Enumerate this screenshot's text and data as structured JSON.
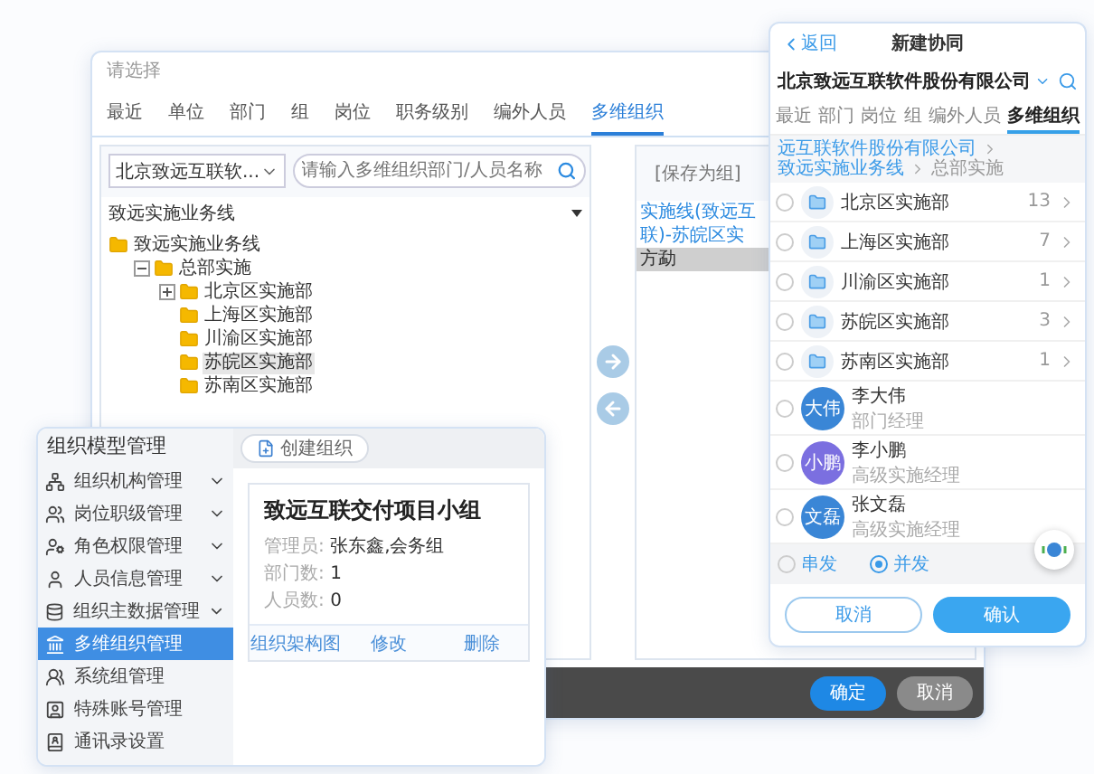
{
  "selector_dialog": {
    "title": "请选择",
    "tabs": [
      {
        "label": "最近",
        "selected": false
      },
      {
        "label": "单位",
        "selected": false
      },
      {
        "label": "部门",
        "selected": false
      },
      {
        "label": "组",
        "selected": false
      },
      {
        "label": "岗位",
        "selected": false
      },
      {
        "label": "职务级别",
        "selected": false
      },
      {
        "label": "编外人员",
        "selected": false
      },
      {
        "label": "多维组织",
        "selected": true
      }
    ],
    "unit_select": {
      "value": "北京致远互联软..."
    },
    "search": {
      "placeholder": "请输入多维组织部门/人员名称"
    },
    "tree_header": "致远实施业务线",
    "tree": [
      {
        "label": "致远实施业务线",
        "selected": false,
        "children": [
          {
            "label": "总部实施",
            "selected": false,
            "expanded": true,
            "children": [
              {
                "label": "北京区实施部",
                "selected": false,
                "expanded": false
              },
              {
                "label": "上海区实施部",
                "selected": false
              },
              {
                "label": "川渝区实施部",
                "selected": false
              },
              {
                "label": "苏皖区实施部",
                "selected": true
              },
              {
                "label": "苏南区实施部",
                "selected": false
              }
            ]
          }
        ]
      }
    ],
    "selected_panel": {
      "save_link": "[保存为组]",
      "items": [
        {
          "label": "实施线(致远互联)-苏皖区实",
          "kind": "path",
          "selected": false
        },
        {
          "label": "方勐",
          "kind": "person",
          "selected": true
        }
      ]
    },
    "buttons": [
      {
        "label": "确定",
        "kind": "primary"
      },
      {
        "label": "取消",
        "kind": "secondary"
      }
    ]
  },
  "org_admin": {
    "title": "组织模型管理",
    "menu": [
      {
        "label": "组织机构管理",
        "expandable": true,
        "selected": false
      },
      {
        "label": "岗位职级管理",
        "expandable": true,
        "selected": false
      },
      {
        "label": "角色权限管理",
        "expandable": true,
        "selected": false
      },
      {
        "label": "人员信息管理",
        "expandable": true,
        "selected": false
      },
      {
        "label": "组织主数据管理",
        "expandable": true,
        "selected": false
      },
      {
        "label": "多维组织管理",
        "expandable": false,
        "selected": true
      },
      {
        "label": "系统组管理",
        "expandable": false,
        "selected": false
      },
      {
        "label": "特殊账号管理",
        "expandable": false,
        "selected": false
      },
      {
        "label": "通讯录设置",
        "expandable": false,
        "selected": false
      }
    ],
    "create_button": "创建组织",
    "card": {
      "title": "致远互联交付项目小组",
      "fields": [
        {
          "label": "管理员:",
          "value": "张东鑫,会务组"
        },
        {
          "label": "部门数:",
          "value": "1"
        },
        {
          "label": "人员数:",
          "value": "0"
        }
      ],
      "actions": [
        "组织架构图",
        "修改",
        "删除"
      ]
    }
  },
  "mobile": {
    "back": "返回",
    "title": "新建协同",
    "company": "北京致远互联软件股份有限公司",
    "tabs": [
      {
        "label": "最近",
        "selected": false
      },
      {
        "label": "部门",
        "selected": false
      },
      {
        "label": "岗位",
        "selected": false
      },
      {
        "label": "组",
        "selected": false
      },
      {
        "label": "编外人员",
        "selected": false
      },
      {
        "label": "多维组织",
        "selected": true
      }
    ],
    "breadcrumb": [
      {
        "label": "远互联软件股份有限公司",
        "current": false
      },
      {
        "label": "致远实施业务线",
        "current": false
      },
      {
        "label": "总部实施",
        "current": true
      }
    ],
    "rows": [
      {
        "kind": "dept",
        "name": "北京区实施部",
        "count": "13",
        "checked": false
      },
      {
        "kind": "dept",
        "name": "上海区实施部",
        "count": "7",
        "checked": false
      },
      {
        "kind": "dept",
        "name": "川渝区实施部",
        "count": "1",
        "checked": false
      },
      {
        "kind": "dept",
        "name": "苏皖区实施部",
        "count": "3",
        "checked": false
      },
      {
        "kind": "dept",
        "name": "苏南区实施部",
        "count": "1",
        "checked": false
      },
      {
        "kind": "person",
        "name": "李大伟",
        "avatar": "大伟",
        "role": "部门经理",
        "color": "#3a86d6",
        "checked": false
      },
      {
        "kind": "person",
        "name": "李小鹏",
        "avatar": "小鹏",
        "role": "高级实施经理",
        "color": "#7b6fe0",
        "checked": false
      },
      {
        "kind": "person",
        "name": "张文磊",
        "avatar": "文磊",
        "role": "高级实施经理",
        "color": "#3a86d6",
        "checked": false
      }
    ],
    "send_modes": [
      {
        "label": "串发",
        "selected": false
      },
      {
        "label": "并发",
        "selected": true
      }
    ],
    "buttons": [
      {
        "label": "取消",
        "kind": "secondary"
      },
      {
        "label": "确认",
        "kind": "primary"
      }
    ]
  }
}
